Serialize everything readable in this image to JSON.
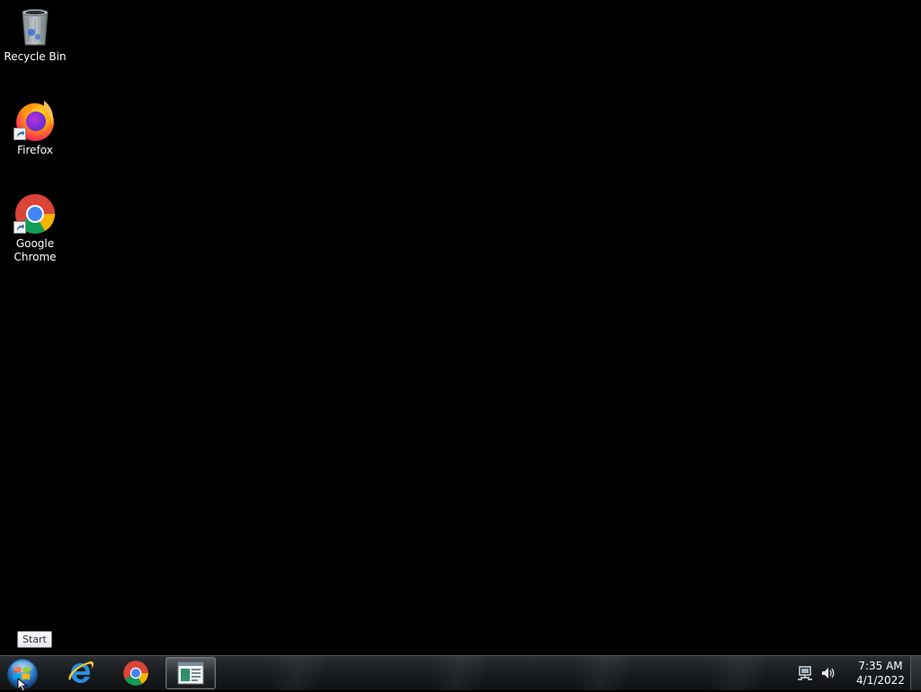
{
  "desktop": {
    "icons": [
      {
        "label": "Recycle Bin",
        "icon": "recycle-bin-icon"
      },
      {
        "label": "Firefox",
        "icon": "firefox-icon"
      },
      {
        "label": "Google\nChrome",
        "icon": "chrome-icon"
      }
    ],
    "background_color": "#000000"
  },
  "tooltip": {
    "text": "Start"
  },
  "taskbar": {
    "start": {
      "icon": "windows-start-orb-icon"
    },
    "pinned": [
      {
        "icon": "internet-explorer-icon"
      },
      {
        "icon": "chrome-icon"
      },
      {
        "icon": "window-app-icon",
        "active": true
      }
    ],
    "tray": {
      "icons": [
        "network-icon",
        "volume-icon"
      ],
      "time": "7:35 AM",
      "date": "4/1/2022"
    }
  }
}
